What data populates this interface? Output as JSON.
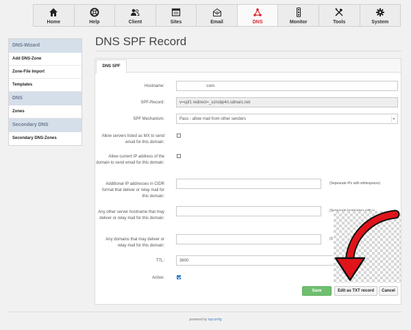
{
  "nav": [
    {
      "label": "Home",
      "icon": "home-icon"
    },
    {
      "label": "Help",
      "icon": "lifebuoy-icon"
    },
    {
      "label": "Client",
      "icon": "users-icon"
    },
    {
      "label": "Sites",
      "icon": "window-icon"
    },
    {
      "label": "Email",
      "icon": "envelope-icon"
    },
    {
      "label": "DNS",
      "icon": "network-icon",
      "active": true
    },
    {
      "label": "Monitor",
      "icon": "traffic-light-icon"
    },
    {
      "label": "Tools",
      "icon": "tools-icon"
    },
    {
      "label": "System",
      "icon": "gear-icon"
    }
  ],
  "sidebar": {
    "sections": [
      {
        "title": "DNS-Wizard",
        "items": [
          "Add DNS-Zone",
          "Zone-File Import",
          "Templates"
        ]
      },
      {
        "title": "DNS",
        "items": [
          "Zones"
        ]
      },
      {
        "title": "Secondary DNS",
        "items": [
          "Secondary DNS-Zones"
        ]
      }
    ]
  },
  "page": {
    "title": "DNS SPF Record",
    "tab": "DNS SPF"
  },
  "form": {
    "hostname_label": "Hostname:",
    "hostname_value": ":com.",
    "spf_record_label": "SPF-Record:",
    "spf_record_value": "v=spf1 redirect=_sznsbp4ri.sdmarc.net",
    "mechanism_label": "SPF Mechanism:",
    "mechanism_value": "Pass - allow mail from other senders",
    "allow_mx_label": "Allow servers listed as MX to send email for this domain:",
    "allow_ip_label": "Allow current IP address of the domain to send email for this domain:",
    "additional_ip_label": "Additional IP addresses in CIDR format that deliver or relay mail for this domain:",
    "additional_ip_hint": "(Sepearate IPs with whitespaces)",
    "other_hosts_label": "Any other server hostname that may deliver or relay mail for this domain:",
    "other_hosts_hint": "(Sepearate hostnames with w",
    "domains_label": "Any domains that may deliver or relay mail for this domain:",
    "domains_hint": "(S",
    "ttl_label": "TTL:",
    "ttl_value": "3600",
    "active_label": "Active:"
  },
  "buttons": {
    "save": "Save",
    "edit_txt": "Edit as TXT record",
    "cancel": "Cancel"
  },
  "footer": {
    "prefix": "powered by",
    "link": "ispconfig"
  },
  "colors": {
    "accent": "#d9232d",
    "save": "#6fbf6f",
    "arrow": "#e1141b"
  }
}
